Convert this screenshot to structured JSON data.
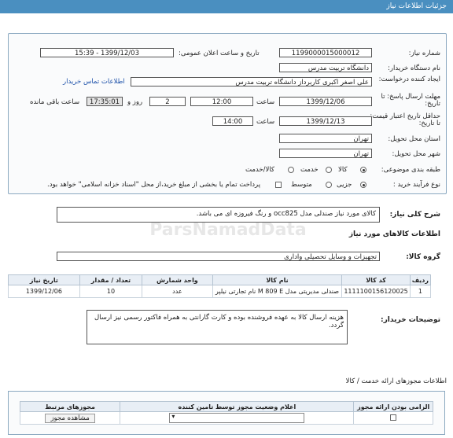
{
  "header": {
    "title": "جزئیات اطلاعات نیاز"
  },
  "form": {
    "need_number_label": "شماره نیاز:",
    "need_number": "1199000015000012",
    "announce_label": "تاریخ و ساعت اعلان عمومی:",
    "announce_value": "1399/12/03 - 15:39",
    "buyer_label": "نام دستگاه خریدار:",
    "buyer_value": "دانشگاه تربیت مدرس",
    "creator_label": "ایجاد کننده درخواست:",
    "creator_value": "علی اصغر اکبری کاربرداز دانشگاه تربیت مدرس",
    "contact_link": "اطلاعات تماس خریدار",
    "deadline_label": "مهلت ارسال پاسخ: تا تاریخ:",
    "deadline_date": "1399/12/06",
    "time_label": "ساعت",
    "deadline_time": "12:00",
    "days_value": "2",
    "days_label": "روز و",
    "remaining_time": "17:35:01",
    "remaining_label": "ساعت باقی مانده",
    "validity_label": "حداقل تاریخ اعتبار قیمت: تا تاریخ:",
    "validity_date": "1399/12/13",
    "validity_time": "14:00",
    "province_label": "استان محل تحویل:",
    "province_value": "تهران",
    "city_label": "شهر محل تحویل:",
    "city_value": "تهران",
    "category_label": "طبقه بندی موضوعی:",
    "cat_goods": "کالا",
    "cat_service": "خدمت",
    "cat_both": "کالا/خدمت",
    "process_label": "نوع فرآیند خرید :",
    "proc_partial": "جزیی",
    "proc_medium": "متوسط",
    "payment_note": "پرداخت تمام یا بخشی از مبلغ خرید،از محل \"اسناد خزانه اسلامی\" خواهد بود."
  },
  "summary": {
    "label": "شرح کلی نیاز:",
    "value": "کالای مورد نیاز صندلی مدل occ825 و رنگ فیروزه ای می باشد."
  },
  "goods_section": {
    "title": "اطلاعات کالاهای مورد نیاز",
    "group_label": "گروه کالا:",
    "group_value": "تجهیزات و وسایل تحصیلی واداری"
  },
  "table": {
    "headers": [
      "ردیف",
      "کد کالا",
      "نام کالا",
      "واحد شمارش",
      "تعداد / مقدار",
      "تاریخ نیاز"
    ],
    "rows": [
      [
        "1",
        "1111100156120025",
        "صندلی مدیریتی مدل M 809 E نام تجارتی نیلپر",
        "عدد",
        "10",
        "1399/12/06"
      ]
    ]
  },
  "notes": {
    "label": "توضیحات خریدار:",
    "value": "هزینه ارسال کالا به عهده فروشنده بوده و کارت گارانتی به همراه فاکتور رسمی نیز ارسال گردد."
  },
  "permits": {
    "title": "اطلاعات مجوزهای ارائه خدمت / کالا",
    "headers": [
      "الزامی بودن ارائه مجوز",
      "اعلام وضعیت مجوز توسط تامین کننده",
      "مجوزهای مرتبط"
    ],
    "view_button": "مشاهده مجوز"
  },
  "watermark": {
    "text": "ParsNamadData"
  },
  "colors": {
    "header_bg": "#4a8fc0",
    "link": "#1a4fa8"
  }
}
